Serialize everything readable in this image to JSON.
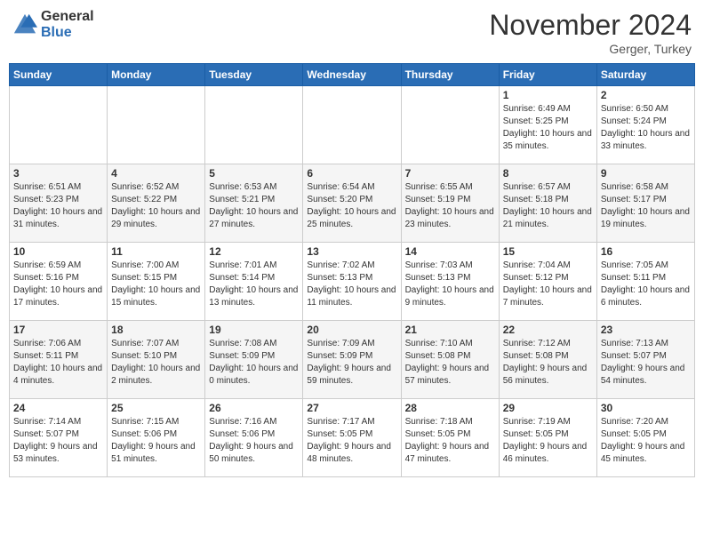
{
  "header": {
    "logo_general": "General",
    "logo_blue": "Blue",
    "month_title": "November 2024",
    "location": "Gerger, Turkey"
  },
  "weekdays": [
    "Sunday",
    "Monday",
    "Tuesday",
    "Wednesday",
    "Thursday",
    "Friday",
    "Saturday"
  ],
  "weeks": [
    [
      {
        "day": "",
        "info": ""
      },
      {
        "day": "",
        "info": ""
      },
      {
        "day": "",
        "info": ""
      },
      {
        "day": "",
        "info": ""
      },
      {
        "day": "",
        "info": ""
      },
      {
        "day": "1",
        "info": "Sunrise: 6:49 AM\nSunset: 5:25 PM\nDaylight: 10 hours and 35 minutes."
      },
      {
        "day": "2",
        "info": "Sunrise: 6:50 AM\nSunset: 5:24 PM\nDaylight: 10 hours and 33 minutes."
      }
    ],
    [
      {
        "day": "3",
        "info": "Sunrise: 6:51 AM\nSunset: 5:23 PM\nDaylight: 10 hours and 31 minutes."
      },
      {
        "day": "4",
        "info": "Sunrise: 6:52 AM\nSunset: 5:22 PM\nDaylight: 10 hours and 29 minutes."
      },
      {
        "day": "5",
        "info": "Sunrise: 6:53 AM\nSunset: 5:21 PM\nDaylight: 10 hours and 27 minutes."
      },
      {
        "day": "6",
        "info": "Sunrise: 6:54 AM\nSunset: 5:20 PM\nDaylight: 10 hours and 25 minutes."
      },
      {
        "day": "7",
        "info": "Sunrise: 6:55 AM\nSunset: 5:19 PM\nDaylight: 10 hours and 23 minutes."
      },
      {
        "day": "8",
        "info": "Sunrise: 6:57 AM\nSunset: 5:18 PM\nDaylight: 10 hours and 21 minutes."
      },
      {
        "day": "9",
        "info": "Sunrise: 6:58 AM\nSunset: 5:17 PM\nDaylight: 10 hours and 19 minutes."
      }
    ],
    [
      {
        "day": "10",
        "info": "Sunrise: 6:59 AM\nSunset: 5:16 PM\nDaylight: 10 hours and 17 minutes."
      },
      {
        "day": "11",
        "info": "Sunrise: 7:00 AM\nSunset: 5:15 PM\nDaylight: 10 hours and 15 minutes."
      },
      {
        "day": "12",
        "info": "Sunrise: 7:01 AM\nSunset: 5:14 PM\nDaylight: 10 hours and 13 minutes."
      },
      {
        "day": "13",
        "info": "Sunrise: 7:02 AM\nSunset: 5:13 PM\nDaylight: 10 hours and 11 minutes."
      },
      {
        "day": "14",
        "info": "Sunrise: 7:03 AM\nSunset: 5:13 PM\nDaylight: 10 hours and 9 minutes."
      },
      {
        "day": "15",
        "info": "Sunrise: 7:04 AM\nSunset: 5:12 PM\nDaylight: 10 hours and 7 minutes."
      },
      {
        "day": "16",
        "info": "Sunrise: 7:05 AM\nSunset: 5:11 PM\nDaylight: 10 hours and 6 minutes."
      }
    ],
    [
      {
        "day": "17",
        "info": "Sunrise: 7:06 AM\nSunset: 5:11 PM\nDaylight: 10 hours and 4 minutes."
      },
      {
        "day": "18",
        "info": "Sunrise: 7:07 AM\nSunset: 5:10 PM\nDaylight: 10 hours and 2 minutes."
      },
      {
        "day": "19",
        "info": "Sunrise: 7:08 AM\nSunset: 5:09 PM\nDaylight: 10 hours and 0 minutes."
      },
      {
        "day": "20",
        "info": "Sunrise: 7:09 AM\nSunset: 5:09 PM\nDaylight: 9 hours and 59 minutes."
      },
      {
        "day": "21",
        "info": "Sunrise: 7:10 AM\nSunset: 5:08 PM\nDaylight: 9 hours and 57 minutes."
      },
      {
        "day": "22",
        "info": "Sunrise: 7:12 AM\nSunset: 5:08 PM\nDaylight: 9 hours and 56 minutes."
      },
      {
        "day": "23",
        "info": "Sunrise: 7:13 AM\nSunset: 5:07 PM\nDaylight: 9 hours and 54 minutes."
      }
    ],
    [
      {
        "day": "24",
        "info": "Sunrise: 7:14 AM\nSunset: 5:07 PM\nDaylight: 9 hours and 53 minutes."
      },
      {
        "day": "25",
        "info": "Sunrise: 7:15 AM\nSunset: 5:06 PM\nDaylight: 9 hours and 51 minutes."
      },
      {
        "day": "26",
        "info": "Sunrise: 7:16 AM\nSunset: 5:06 PM\nDaylight: 9 hours and 50 minutes."
      },
      {
        "day": "27",
        "info": "Sunrise: 7:17 AM\nSunset: 5:05 PM\nDaylight: 9 hours and 48 minutes."
      },
      {
        "day": "28",
        "info": "Sunrise: 7:18 AM\nSunset: 5:05 PM\nDaylight: 9 hours and 47 minutes."
      },
      {
        "day": "29",
        "info": "Sunrise: 7:19 AM\nSunset: 5:05 PM\nDaylight: 9 hours and 46 minutes."
      },
      {
        "day": "30",
        "info": "Sunrise: 7:20 AM\nSunset: 5:05 PM\nDaylight: 9 hours and 45 minutes."
      }
    ]
  ]
}
